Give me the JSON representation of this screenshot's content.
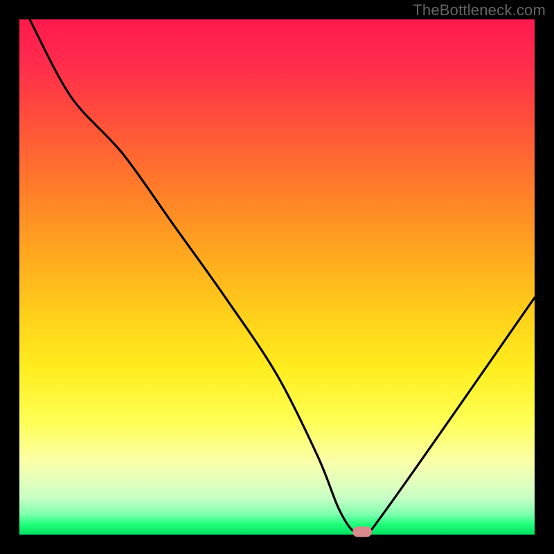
{
  "watermark": "TheBottleneck.com",
  "chart_data": {
    "type": "line",
    "title": "",
    "xlabel": "",
    "ylabel": "",
    "xlim": [
      0,
      100
    ],
    "ylim": [
      0,
      100
    ],
    "grid": false,
    "series": [
      {
        "name": "bottleneck-curve",
        "x": [
          2,
          10,
          20,
          30,
          40,
          50,
          58,
          62,
          65,
          68,
          100
        ],
        "y": [
          100,
          85,
          74,
          60,
          46,
          31,
          15,
          5,
          0.5,
          0.5,
          46
        ]
      }
    ],
    "annotations": [
      {
        "name": "optimal-point",
        "x": 66.5,
        "y": 0.5
      }
    ],
    "background_gradient": {
      "top": "#ff1a4d",
      "mid": "#ffee1f",
      "bottom": "#00e060"
    }
  }
}
